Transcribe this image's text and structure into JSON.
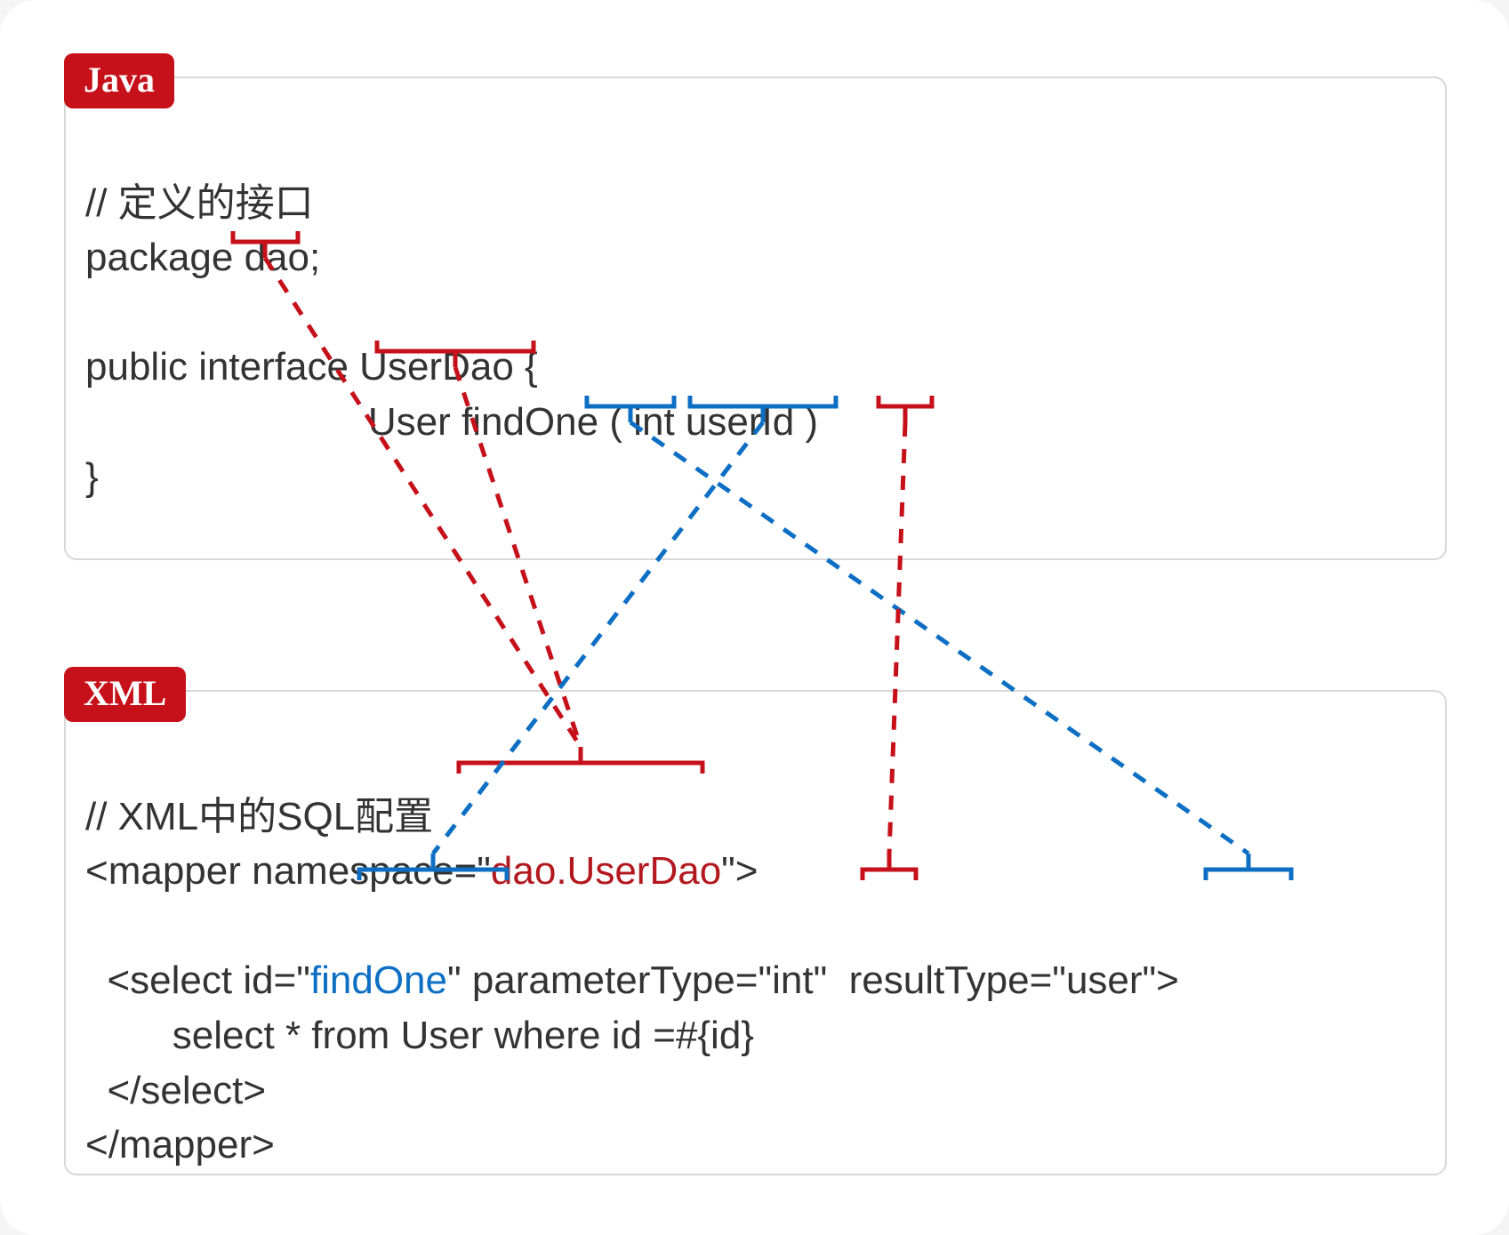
{
  "java": {
    "tag": "Java",
    "comment": "// 定义的接口",
    "pkg_kw": "package ",
    "pkg_name": "dao",
    "pkg_semi": ";",
    "iface_decl": "public interface UserDao {",
    "method_indent": "                          ",
    "method_ret": "User",
    "method_sp1": " ",
    "method_name": "findOne",
    "method_sp2": " ( ",
    "method_ptype": "int",
    "method_rest": " userId )",
    "close": "}"
  },
  "xml": {
    "tag": "XML",
    "comment": "// XML中的SQL配置",
    "mapper_open1": "<mapper namespace=\"",
    "namespace": "dao.UserDao",
    "mapper_open2": "\">",
    "select_indent": "  ",
    "select_open1": "<select id=\"",
    "id": "findOne",
    "select_open2": "\" parameterType=\"",
    "ptype": "int",
    "select_open3": "\"  resultType=\"",
    "rtype": "user",
    "select_open4": "\">",
    "sql_indent": "        ",
    "sql": "select * from User where id =#{id}",
    "select_close_indent": "  ",
    "select_close": "</select>",
    "mapper_close": "</mapper>"
  },
  "colors": {
    "red": "#c6101a",
    "blue": "#0d6fc4",
    "border": "#d8d8d8",
    "text": "#333333"
  },
  "connections": [
    {
      "from": "java.dao",
      "to": "xml.namespace",
      "color": "red"
    },
    {
      "from": "java.UserDao",
      "to": "xml.namespace",
      "color": "red"
    },
    {
      "from": "java.User",
      "to": "xml.resultType",
      "color": "blue"
    },
    {
      "from": "java.findOne",
      "to": "xml.id",
      "color": "blue"
    },
    {
      "from": "java.int",
      "to": "xml.parameterType",
      "color": "red"
    }
  ]
}
